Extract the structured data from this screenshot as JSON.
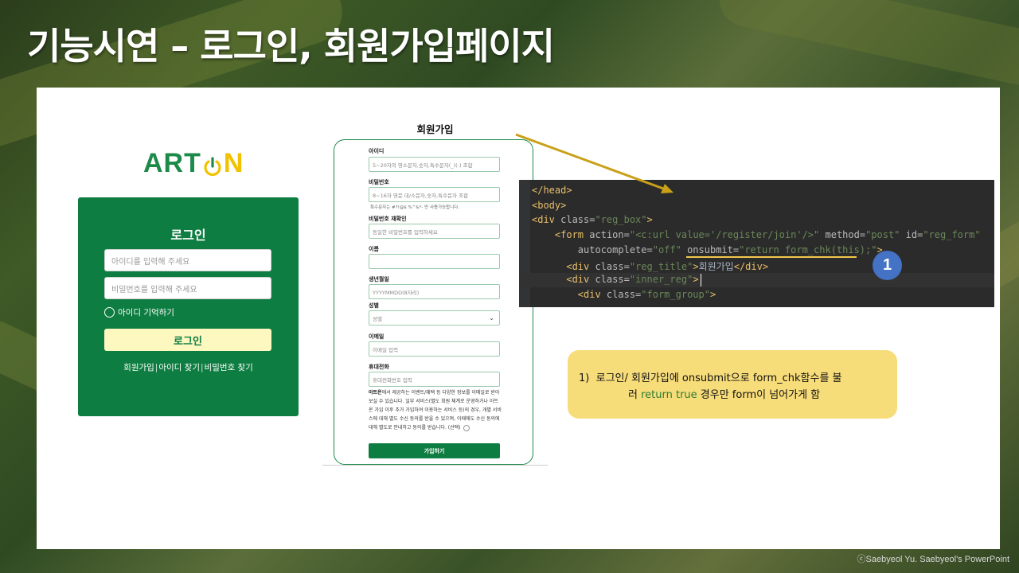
{
  "slide": {
    "title": "기능시연 – 로그인, 회원가입페이지",
    "credit": "ⓒSaebyeol Yu. Saebyeol's PowerPoint"
  },
  "logo": {
    "part1": "ART",
    "part2": "N",
    "colors": {
      "green": "#1e8a4a",
      "yellow": "#f2c200"
    }
  },
  "login": {
    "title": "로그인",
    "id_placeholder": "아이디를 입력해 주세요",
    "pw_placeholder": "비밀번호를 입력해 주세요",
    "remember_label": "아이디 기억하기",
    "button_label": "로그인",
    "links": [
      "회원가입",
      "아이디 찾기",
      "비밀번호 찾기"
    ]
  },
  "register": {
    "heading": "회원가입",
    "fields": {
      "id_label": "아이디",
      "id_placeholder": "5~20자의 영소문자,숫자,특수문자(_)(-) 조합",
      "pw_label": "비밀번호",
      "pw_placeholder": "8~16자 영문 대/소문자,숫자,특수문자 조합",
      "pw_hint": "특수문자는 #?!@$ %^&*- 만 사용가능합니다.",
      "pw_confirm_label": "비밀번호 재확인",
      "pw_confirm_placeholder": "동일한 비밀번호를 입력하세요",
      "name_label": "이름",
      "birth_label": "생년월일",
      "birth_placeholder": "YYYYMMDD(8자리)",
      "gender_label": "성별",
      "gender_value": "성별",
      "email_label": "이메일",
      "email_placeholder": "이메일 입력",
      "phone_label": "휴대전화",
      "phone_placeholder": "휴대전화번호 입력"
    },
    "terms_brand": "아트온",
    "terms_text": "에서 제공하는 이벤트/혜택 등 다양한 정보를 이메일로 받아보실 수 있습니다. 일부 서비스(별도 회원 체계로 운영하거나 아트온 가입 이후 추가 가입하여 이용하는 서비스 등)의 경우, 개별 서비스에 대해 별도 수신 동의를 받을 수 있으며, 이때에도 수신 동의에 대해 별도로 안내하고 동의를 받습니다. (선택)",
    "button_label": "가입하기"
  },
  "code": {
    "lines": [
      {
        "indent": "",
        "parts": [
          [
            "tag",
            "</head>"
          ]
        ]
      },
      {
        "indent": "",
        "parts": [
          [
            "tag",
            "<body>"
          ]
        ]
      },
      {
        "indent": "",
        "parts": [
          [
            "tag",
            "<div "
          ],
          [
            "attr",
            "class="
          ],
          [
            "str",
            "\"reg_box\""
          ],
          [
            "tag",
            ">"
          ]
        ]
      },
      {
        "indent": "    ",
        "parts": [
          [
            "tag",
            "<form "
          ],
          [
            "attr",
            "action="
          ],
          [
            "str",
            "\"<c:url value='/register/join'/>\""
          ],
          [
            "attr",
            " method="
          ],
          [
            "str",
            "\"post\""
          ],
          [
            "attr",
            " id="
          ],
          [
            "str",
            "\"reg_form\""
          ]
        ]
      },
      {
        "indent": "        ",
        "parts": [
          [
            "attr",
            "autocomplete="
          ],
          [
            "str",
            "\"off\""
          ],
          [
            "attr",
            " onsubmit="
          ],
          [
            "str",
            "\"return form_chk(this);\""
          ],
          [
            "tag",
            ">"
          ]
        ]
      },
      {
        "indent": "      ",
        "parts": [
          [
            "tag",
            "<div "
          ],
          [
            "attr",
            "class="
          ],
          [
            "str",
            "\"reg_title\""
          ],
          [
            "tag",
            ">"
          ],
          [
            "plain",
            "회원가입"
          ],
          [
            "tag",
            "</div>"
          ]
        ]
      },
      {
        "indent": "      ",
        "parts": [
          [
            "tag",
            "<div "
          ],
          [
            "attr",
            "class="
          ],
          [
            "str",
            "\"inner_reg\""
          ],
          [
            "tag",
            ">"
          ]
        ]
      },
      {
        "indent": "        ",
        "parts": [
          [
            "tag",
            "<div "
          ],
          [
            "attr",
            "class="
          ],
          [
            "str",
            "\"form_group\""
          ],
          [
            "tag",
            ">"
          ]
        ]
      }
    ]
  },
  "badge": "1",
  "note": {
    "num": "1)",
    "line1": "로그인/ 회원가입에 onsubmit으로 form_chk함수를 불",
    "line2_pre": "러 ",
    "line2_green": "return true",
    "line2_post": " 경우만 form이 넘어가게 함"
  }
}
